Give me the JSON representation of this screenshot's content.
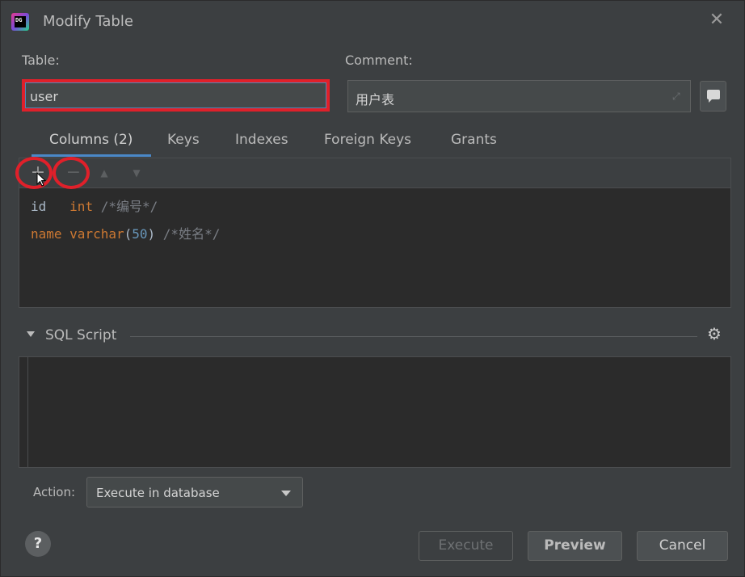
{
  "window": {
    "title": "Modify Table",
    "app_icon_text": "DG"
  },
  "form": {
    "table_label": "Table:",
    "table_value": "user",
    "comment_label": "Comment:",
    "comment_value": "用户表"
  },
  "tabs": [
    {
      "label": "Columns (2)",
      "active": true
    },
    {
      "label": "Keys"
    },
    {
      "label": "Indexes"
    },
    {
      "label": "Foreign Keys"
    },
    {
      "label": "Grants"
    }
  ],
  "toolbar": {
    "add": "+",
    "remove": "−",
    "up": "▲",
    "down": "▼"
  },
  "columns": [
    {
      "name": "id",
      "type": "int",
      "size": "",
      "comment": "/*编号*/"
    },
    {
      "name": "name",
      "type": "varchar",
      "size": "50",
      "comment": "/*姓名*/"
    }
  ],
  "sql_script": {
    "title": "SQL Script"
  },
  "action": {
    "label": "Action:",
    "selected": "Execute in database"
  },
  "buttons": {
    "help": "?",
    "execute": "Execute",
    "preview": "Preview",
    "cancel": "Cancel"
  },
  "colors": {
    "highlight": "#e0202a",
    "accent": "#4a88c7",
    "keyword": "#cc7832",
    "number": "#6897bb"
  }
}
